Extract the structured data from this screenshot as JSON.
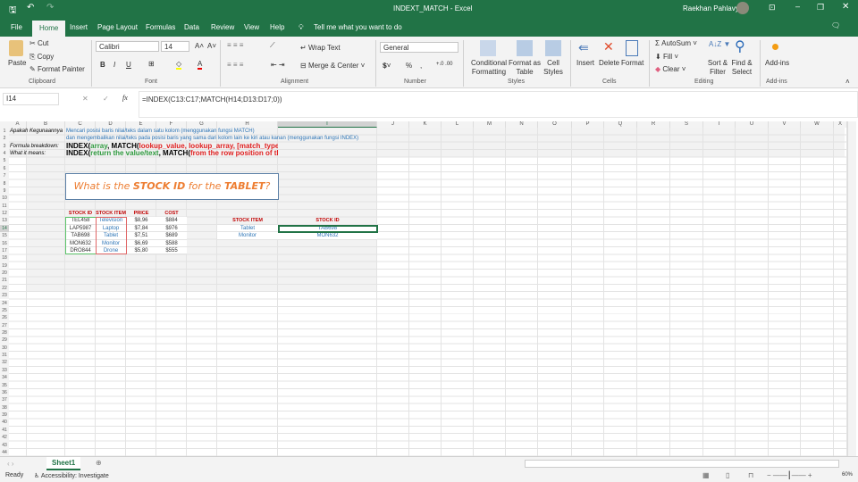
{
  "window": {
    "title": "INDEXT_MATCH  -  Excel",
    "user": "Raekhan Pahlavy"
  },
  "tabs": [
    "File",
    "Home",
    "Insert",
    "Page Layout",
    "Formulas",
    "Data",
    "Review",
    "View",
    "Help"
  ],
  "tell_me": "Tell me what you want to do",
  "ribbon": {
    "clipboard": {
      "paste": "Paste",
      "cut": "Cut",
      "copy": "Copy",
      "format_painter": "Format Painter",
      "label": "Clipboard"
    },
    "font": {
      "name": "Calibri",
      "size": "14",
      "bold": "B",
      "italic": "I",
      "underline": "U",
      "label": "Font"
    },
    "alignment": {
      "wrap": "Wrap Text",
      "merge": "Merge & Center",
      "label": "Alignment"
    },
    "number": {
      "format": "General",
      "percent": "%",
      "comma": ",",
      "label": "Number"
    },
    "styles": {
      "conditional": "Conditional Formatting",
      "format_table": "Format as Table",
      "cell_styles": "Cell Styles",
      "label": "Styles"
    },
    "cells": {
      "insert": "Insert",
      "delete": "Delete",
      "format": "Format",
      "label": "Cells"
    },
    "editing": {
      "autosum": "AutoSum",
      "fill": "Fill",
      "clear": "Clear",
      "sort": "Sort & Filter",
      "find": "Find & Select",
      "label": "Editing"
    },
    "addins": {
      "button": "Add-ins",
      "label": "Add-ins"
    }
  },
  "formula_bar": {
    "name_box": "I14",
    "formula": "=INDEX(C13:C17;MATCH(H14;D13:D17;0))"
  },
  "columns": [
    "A",
    "B",
    "C",
    "D",
    "E",
    "F",
    "G",
    "H",
    "I",
    "J",
    "K",
    "L",
    "M",
    "N",
    "O",
    "P",
    "Q",
    "R",
    "S",
    "T",
    "U",
    "V",
    "W",
    "X"
  ],
  "row_count": 45,
  "sheet": {
    "r1_label": "Apakah Kegunaannya",
    "r1_text": "Mencari posisi baris nilai/teks dalam satu kolom (menggunakan fungsi MATCH)",
    "r2_text": "dan mengembalikan nilai/teks pada posisi baris yang sama dari kolom lain ke kiri atau kanan (menggunakan fungsi INDEX)",
    "r3_label": "Formula breakdown:",
    "r3_a": "INDEX(",
    "r3_b": "array",
    "r3_c": ", MATCH(",
    "r3_d": "lookup_value, lookup_array, [match_type",
    "r4_label": "What it means:",
    "r4_a": "INDEX(",
    "r4_b": "return the value/text",
    "r4_c": ", MATCH(",
    "r4_d": "from the row position of th",
    "question_pre": "What is the ",
    "question_b1": "STOCK ID",
    "question_mid": " for the ",
    "question_b2": "TABLET",
    "question_post": "?",
    "table_headers": [
      "STOCK ID",
      "STOCK ITEM",
      "PRICE",
      "COST"
    ],
    "table_rows": [
      [
        "TEL458",
        "Television",
        "$8,96",
        "$884"
      ],
      [
        "LAP5987",
        "Laptop",
        "$7,84",
        "$976"
      ],
      [
        "TAB698",
        "Tablet",
        "$7,51",
        "$689"
      ],
      [
        "MON632",
        "Monitor",
        "$6,69",
        "$588"
      ],
      [
        "DRO844",
        "Drone",
        "$5,80",
        "$555"
      ]
    ],
    "lookup_headers": [
      "STOCK ITEM",
      "STOCK ID"
    ],
    "lookup_rows": [
      [
        "Tablet",
        "TAB698"
      ],
      [
        "Monitor",
        "MON632"
      ]
    ]
  },
  "sheet_tab": "Sheet1",
  "status": {
    "ready": "Ready",
    "accessibility": "Accessibility: Investigate",
    "zoom": "60%"
  }
}
